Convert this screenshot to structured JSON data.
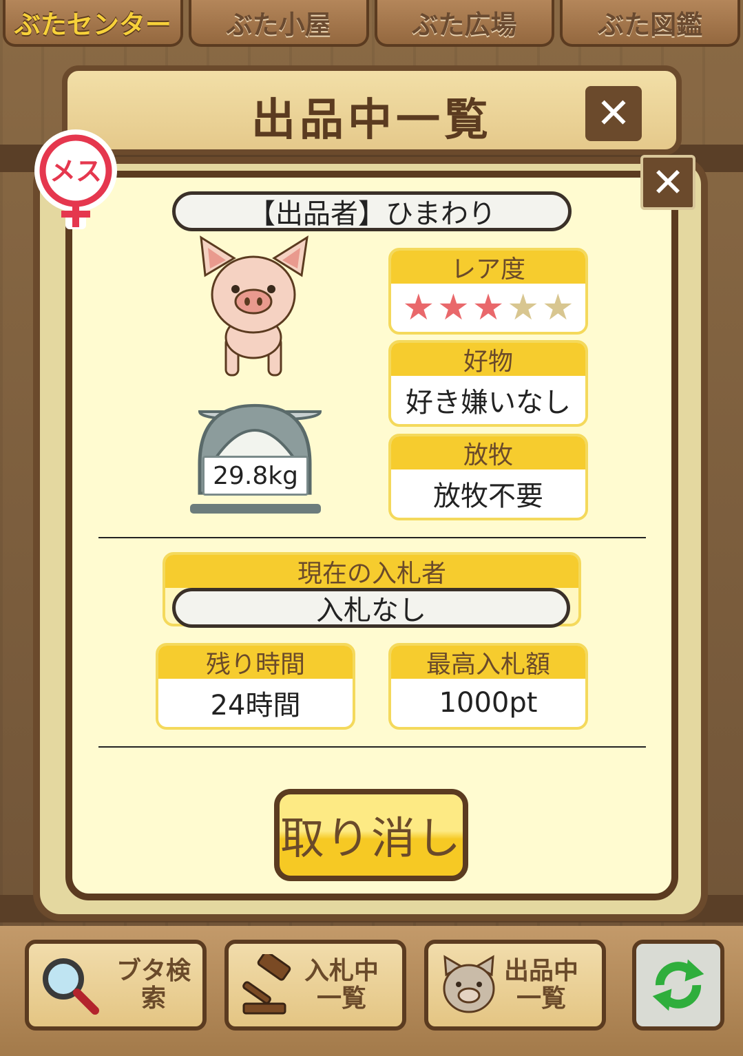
{
  "top_tabs": [
    {
      "label": "ぶたセンター",
      "active": true
    },
    {
      "label": "ぶた小屋",
      "active": false
    },
    {
      "label": "ぶた広場",
      "active": false
    },
    {
      "label": "ぶた図鑑",
      "active": false
    }
  ],
  "dialog": {
    "title": "出品中一覧",
    "close_icon": "✕"
  },
  "listing": {
    "gender_label": "メス",
    "seller_label": "【出品者】ひまわり",
    "weight": "29.8kg",
    "rarity": {
      "header": "レア度",
      "stars_filled": 3,
      "stars_total": 5
    },
    "favorite": {
      "header": "好物",
      "value": "好き嫌いなし"
    },
    "grazing": {
      "header": "放牧",
      "value": "放牧不要"
    },
    "current_bidder": {
      "header": "現在の入札者",
      "value": "入札なし"
    },
    "time_left": {
      "header": "残り時間",
      "value": "24時間"
    },
    "highest_bid": {
      "header": "最高入札額",
      "value": "1000pt"
    },
    "cancel_label": "取り消し"
  },
  "bottom_nav": {
    "search": "ブタ検索",
    "bidding_line1": "入札中",
    "bidding_line2": "一覧",
    "listing_line1": "出品中",
    "listing_line2": "一覧"
  },
  "colors": {
    "header_yellow": "#f6cc2e",
    "panel_bg": "#fffbd0",
    "wood_dark": "#5b3b20",
    "star_on": "#e9686b",
    "star_off": "#d8c690"
  }
}
